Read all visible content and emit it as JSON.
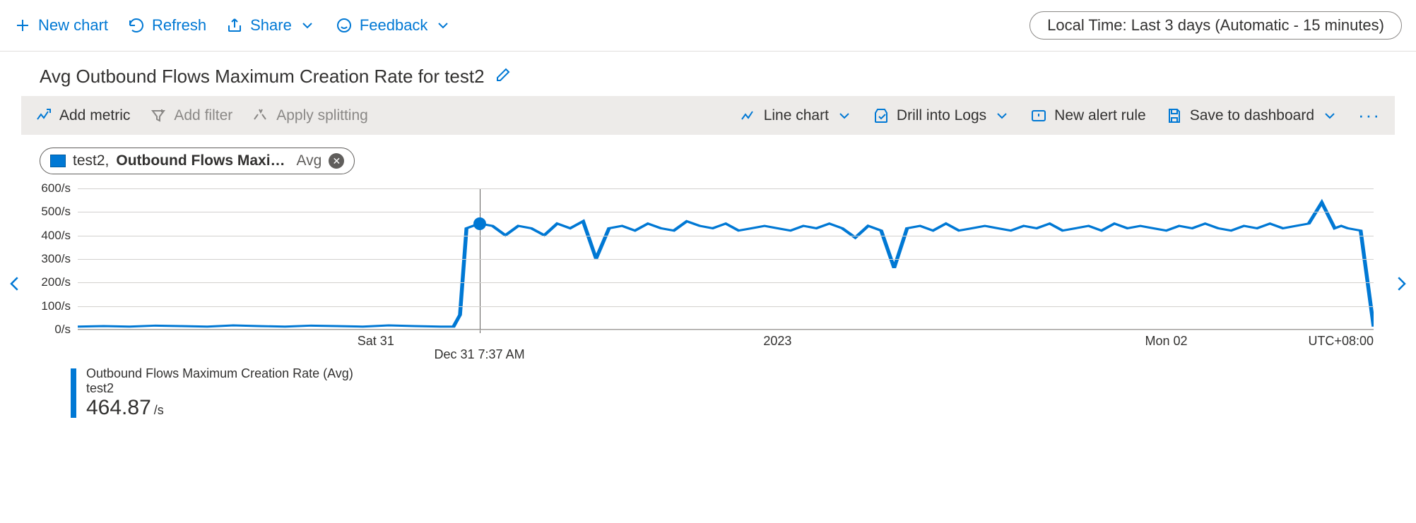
{
  "topbar": {
    "new_chart": "New chart",
    "refresh": "Refresh",
    "share": "Share",
    "feedback": "Feedback",
    "time_pill": "Local Time: Last 3 days (Automatic - 15 minutes)"
  },
  "title": "Avg Outbound Flows Maximum Creation Rate for test2",
  "toolbar": {
    "add_metric": "Add metric",
    "add_filter": "Add filter",
    "apply_splitting": "Apply splitting",
    "viz": "Line chart",
    "drill": "Drill into Logs",
    "alert": "New alert rule",
    "save": "Save to dashboard"
  },
  "chip": {
    "scope": "test2,",
    "metric": "Outbound Flows Maxi…",
    "agg": "Avg"
  },
  "legend": {
    "name": "Outbound Flows Maximum Creation Rate (Avg)",
    "sub": "test2",
    "value": "464.87",
    "unit": "/s"
  },
  "hover": {
    "label": "Dec 31 7:37 AM",
    "x_pct": 31.0,
    "y_val": 450
  },
  "chart_data": {
    "type": "line",
    "title": "Avg Outbound Flows Maximum Creation Rate for test2",
    "ylabel": "/s",
    "ylim": [
      0,
      600
    ],
    "y_ticks": [
      "0/s",
      "100/s",
      "200/s",
      "300/s",
      "400/s",
      "500/s",
      "600/s"
    ],
    "x_ticks": [
      {
        "label": "Sat 31",
        "pct": 23
      },
      {
        "label": "2023",
        "pct": 54
      },
      {
        "label": "Mon 02",
        "pct": 84
      },
      {
        "label": "UTC+08:00",
        "pct": 100,
        "align": "right"
      }
    ],
    "x": [
      0,
      2,
      4,
      6,
      8,
      10,
      12,
      14,
      16,
      18,
      20,
      22,
      24,
      26,
      28,
      29,
      29.5,
      30,
      31,
      32,
      33,
      34,
      35,
      36,
      37,
      38,
      39,
      40,
      41,
      42,
      43,
      44,
      45,
      46,
      47,
      48,
      49,
      50,
      51,
      52,
      53,
      54,
      55,
      56,
      57,
      58,
      59,
      60,
      61,
      62,
      63,
      64,
      65,
      66,
      67,
      68,
      69,
      70,
      71,
      72,
      73,
      74,
      75,
      76,
      77,
      78,
      79,
      80,
      81,
      82,
      83,
      84,
      85,
      86,
      87,
      88,
      89,
      90,
      91,
      92,
      93,
      94,
      95,
      96,
      97,
      97.5,
      98,
      99,
      100
    ],
    "values": [
      10,
      12,
      10,
      14,
      12,
      10,
      15,
      12,
      10,
      14,
      12,
      10,
      15,
      12,
      10,
      10,
      60,
      430,
      450,
      440,
      400,
      440,
      430,
      400,
      450,
      430,
      460,
      300,
      430,
      440,
      420,
      450,
      430,
      420,
      460,
      440,
      430,
      450,
      420,
      430,
      440,
      430,
      420,
      440,
      430,
      450,
      430,
      390,
      440,
      420,
      260,
      430,
      440,
      420,
      450,
      420,
      430,
      440,
      430,
      420,
      440,
      430,
      450,
      420,
      430,
      440,
      420,
      450,
      430,
      440,
      430,
      420,
      440,
      430,
      450,
      430,
      420,
      440,
      430,
      450,
      430,
      440,
      450,
      540,
      430,
      440,
      430,
      420,
      10
    ],
    "series_name": "Outbound Flows Maximum Creation Rate (Avg)"
  }
}
